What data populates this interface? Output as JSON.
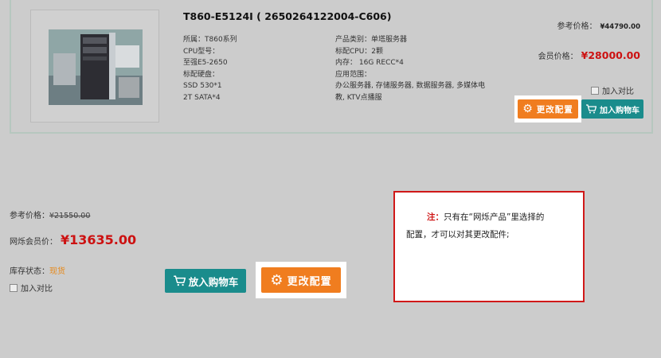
{
  "product": {
    "title": "T860-E5124I ( 2650264122004-C606)",
    "specs_left": [
      "所属：T860系列",
      "CPU型号：",
      "至强E5-2650",
      "标配硬盘：",
      "SSD 530*1",
      "2T SATA*4"
    ],
    "specs_right": [
      "产品类别：单塔服务器",
      "标配CPU：2颗",
      "内存： 16G RECC*4",
      "应用范围：",
      "办公服务器, 存储服务器, 数据服务器, 多媒体电教, KTV点播服"
    ],
    "ref_price_label": "参考价格：",
    "ref_price_value": "¥44790.00",
    "member_price_label": "会员价格：",
    "member_price_value": "¥28000.00",
    "compare_label": "加入对比",
    "change_config_label": "更改配置",
    "add_cart_label": "加入购物车"
  },
  "bottom": {
    "ref_price_label": "参考价格：",
    "ref_price_value": "¥21550.00",
    "member_price_label": "网烁会员价：",
    "member_price_value": "¥13635.00",
    "stock_label": "库存状态：",
    "stock_value": "现货",
    "compare_label": "加入对比",
    "add_cart_label": "放入购物车",
    "change_config_label": "更改配置"
  },
  "note": {
    "head": "注：",
    "text_1": "只有在“网烁产品”里选择的",
    "text_2": "配置，才可以对其更改配件;"
  },
  "colors": {
    "background": "#cccccc",
    "price_red": "#cc1111",
    "button_orange": "#f07d1f",
    "button_teal": "#1a8c8c",
    "note_border": "#d01818"
  }
}
